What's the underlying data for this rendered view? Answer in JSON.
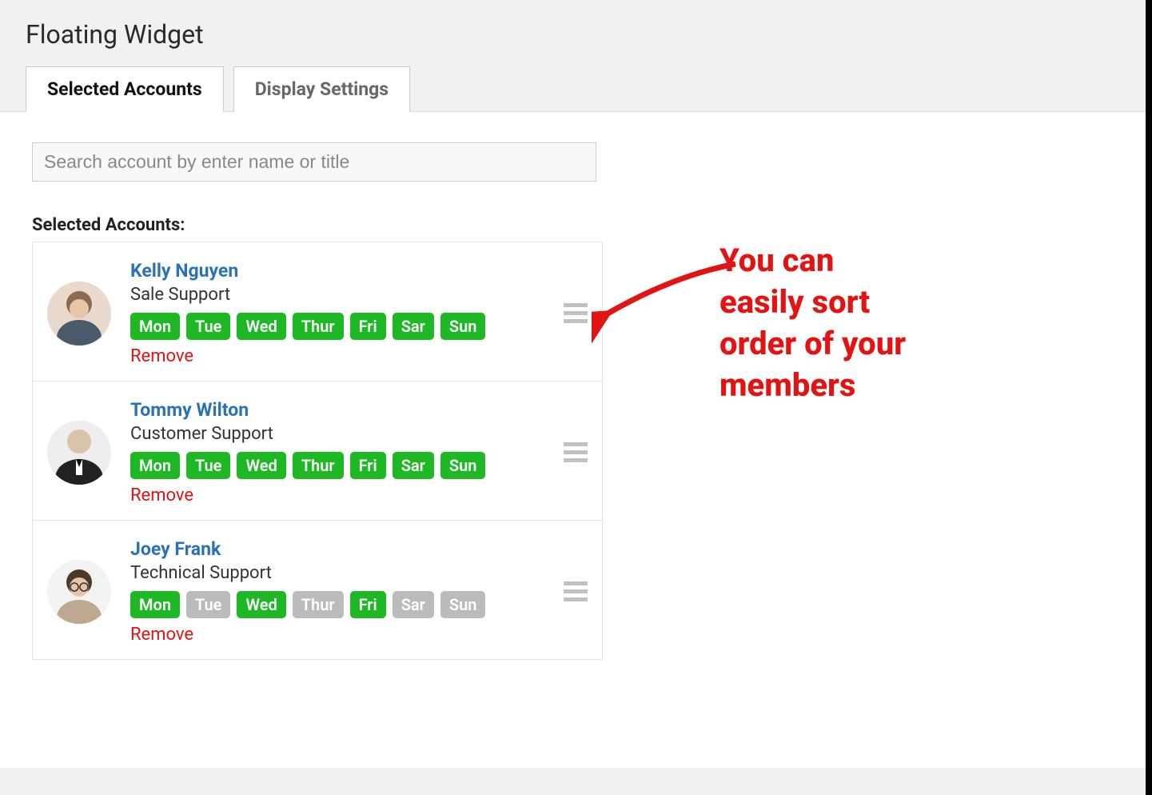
{
  "header": {
    "title": "Floating Widget"
  },
  "tabs": [
    {
      "label": "Selected Accounts",
      "active": true
    },
    {
      "label": "Display Settings",
      "active": false
    }
  ],
  "search": {
    "placeholder": "Search account by enter name or title"
  },
  "section_label": "Selected Accounts:",
  "remove_label": "Remove",
  "days": [
    "Mon",
    "Tue",
    "Wed",
    "Thur",
    "Fri",
    "Sar",
    "Sun"
  ],
  "accounts": [
    {
      "name": "Kelly Nguyen",
      "role": "Sale Support",
      "days_on": [
        true,
        true,
        true,
        true,
        true,
        true,
        true
      ]
    },
    {
      "name": "Tommy Wilton",
      "role": "Customer Support",
      "days_on": [
        true,
        true,
        true,
        true,
        true,
        true,
        true
      ]
    },
    {
      "name": "Joey Frank",
      "role": "Technical Support",
      "days_on": [
        true,
        false,
        true,
        false,
        true,
        false,
        false
      ]
    }
  ],
  "callout": {
    "line1": "You can",
    "line2": "easily sort",
    "line3": "order of your",
    "line4": "members"
  }
}
